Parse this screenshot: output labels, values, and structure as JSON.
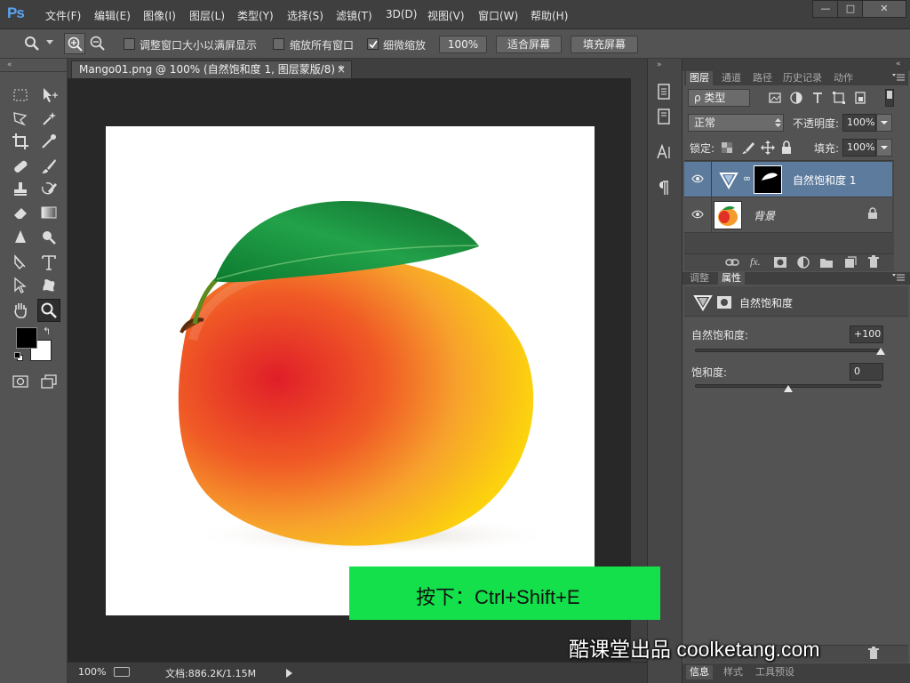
{
  "app": {
    "logo": "Ps"
  },
  "menu": [
    "文件(F)",
    "编辑(E)",
    "图像(I)",
    "图层(L)",
    "类型(Y)",
    "选择(S)",
    "滤镜(T)",
    "3D(D)",
    "视图(V)",
    "窗口(W)",
    "帮助(H)"
  ],
  "window_controls": {
    "minimize": "—",
    "maximize": "□",
    "close": "✕"
  },
  "options": {
    "resize_windows": "调整窗口大小以满屏显示",
    "zoom_all": "缩放所有窗口",
    "scrubby_zoom": "细微缩放",
    "zoom_pct": "100%",
    "fit_screen": "适合屏幕",
    "fill_screen": "填充屏幕",
    "resize_checked": false,
    "zoom_all_checked": false,
    "scrubby_checked": true
  },
  "document": {
    "tab_title": "Mango01.png @ 100% (自然饱和度 1, 图层蒙版/8) *",
    "tab_close": "×",
    "status_zoom": "100%",
    "status_doc": "文档:886.2K/1.15M"
  },
  "layers_panel": {
    "tabs": [
      "图层",
      "通道",
      "路径",
      "历史记录",
      "动作"
    ],
    "filter_kind": "ρ 类型",
    "blend_mode": "正常",
    "opacity_label": "不透明度:",
    "opacity": "100%",
    "lock_label": "锁定:",
    "fill_label": "填充:",
    "fill": "100%",
    "layers": [
      {
        "name": "自然饱和度 1",
        "selected": true
      },
      {
        "name": "背景",
        "locked": true
      }
    ]
  },
  "properties_panel": {
    "tabs": [
      "调整",
      "属性"
    ],
    "title": "自然饱和度",
    "vibrance_label": "自然饱和度:",
    "vibrance": "+100",
    "saturation_label": "饱和度:",
    "saturation": "0",
    "vibrance_level": 1.0,
    "saturation_level": 0.5
  },
  "bottom_tabs": [
    "信息",
    "样式",
    "工具预设"
  ],
  "overlay": {
    "caption": "按下：Ctrl+Shift+E",
    "watermark": "酷课堂出品 coolketang.com"
  },
  "colors": {
    "accent_selected": "#5c7b9d",
    "caption_bg": "#14e04c"
  }
}
